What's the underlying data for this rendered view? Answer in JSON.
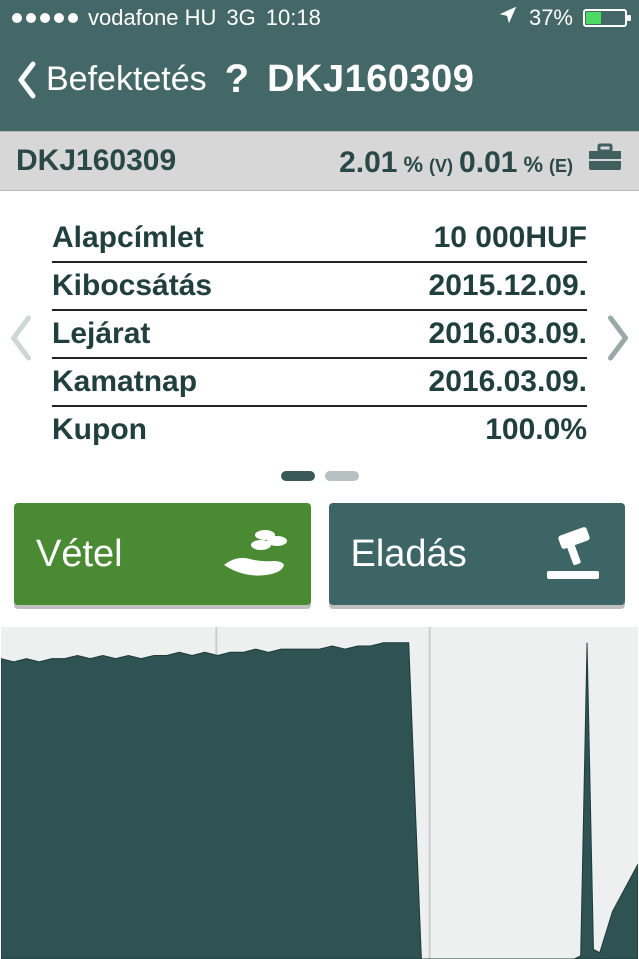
{
  "status": {
    "carrier": "vodafone HU",
    "network": "3G",
    "time": "10:18",
    "battery_percent": "37%"
  },
  "nav": {
    "back_label": "Befektetés",
    "help_label": "?",
    "title": "DKJ160309"
  },
  "summary": {
    "ticker": "DKJ160309",
    "v_value": "2.01",
    "v_pct": "%",
    "v_tag": "(V)",
    "e_value": "0.01",
    "e_pct": "%",
    "e_tag": "(E)"
  },
  "details": {
    "rows": [
      {
        "label": "Alapcímlet",
        "value": "10 000HUF"
      },
      {
        "label": "Kibocsátás",
        "value": "2015.12.09."
      },
      {
        "label": "Lejárat",
        "value": "2016.03.09."
      },
      {
        "label": "Kamatnap",
        "value": "2016.03.09."
      },
      {
        "label": "Kupon",
        "value": "100.0%"
      }
    ],
    "pager": {
      "active": 0,
      "count": 2
    }
  },
  "actions": {
    "buy_label": "Vétel",
    "sell_label": "Eladás"
  },
  "colors": {
    "header": "#446767",
    "buy": "#4a8a33",
    "sell": "#3d6565",
    "card_divider": "#222222",
    "chart_fill": "#2f5252"
  },
  "chart_data": {
    "type": "area",
    "title": "",
    "xlabel": "",
    "ylabel": "",
    "ylim": [
      0,
      105
    ],
    "x": [
      0,
      2,
      4,
      6,
      8,
      10,
      12,
      14,
      16,
      18,
      20,
      22,
      24,
      26,
      28,
      30,
      32,
      34,
      36,
      38,
      40,
      42,
      44,
      46,
      48,
      50,
      52,
      54,
      56,
      58,
      60,
      62,
      64,
      66,
      68,
      70,
      72,
      74,
      76,
      78,
      80,
      82,
      84,
      86,
      88,
      90,
      91,
      92,
      93,
      94,
      96,
      100
    ],
    "values": [
      95,
      94,
      95,
      94,
      95,
      95,
      96,
      95,
      96,
      95,
      96,
      95,
      96,
      96,
      97,
      96,
      97,
      96,
      97,
      97,
      98,
      97,
      98,
      98,
      98,
      98,
      99,
      98,
      99,
      99,
      100,
      100,
      100,
      0,
      0,
      0,
      0,
      0,
      0,
      0,
      0,
      0,
      0,
      0,
      0,
      0,
      1,
      100,
      3,
      2,
      15,
      30
    ]
  }
}
